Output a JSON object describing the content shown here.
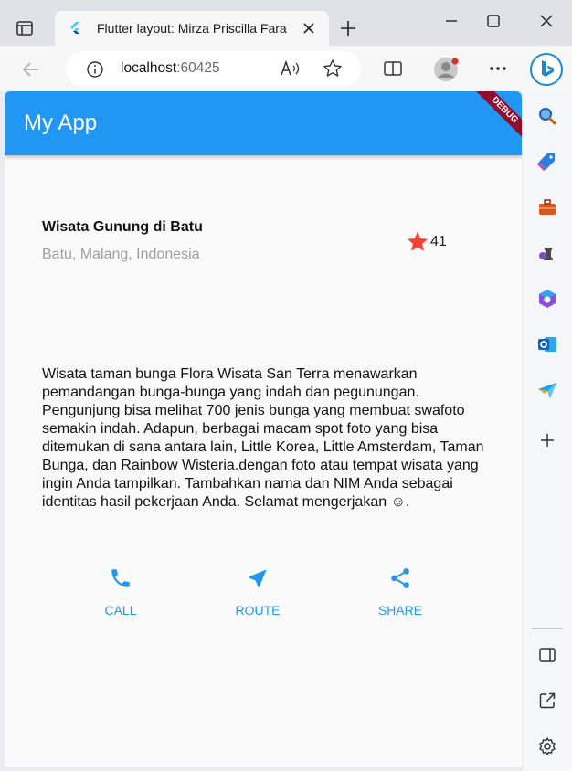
{
  "browser": {
    "tab_title": "Flutter layout: Mirza Priscilla Fara",
    "url_host": "localhost",
    "url_port": ":60425"
  },
  "app": {
    "title": "My App",
    "debug_banner": "DEBUG"
  },
  "place": {
    "name": "Wisata Gunung di Batu",
    "location": "Batu, Malang, Indonesia",
    "star_count": "41"
  },
  "description": "Wisata taman bunga Flora Wisata San Terra menawarkan pemandangan bunga-bunga yang indah dan pegunungan. Pengunjung bisa melihat 700 jenis bunga yang membuat swafoto semakin indah. Adapun, berbagai macam spot foto yang bisa ditemukan di sana antara lain, Little Korea, Little Amsterdam, Taman Bunga, dan Rainbow Wisteria.dengan foto atau tempat wisata yang ingin Anda tampilkan. Tambahkan nama dan NIM Anda sebagai identitas hasil pekerjaan Anda. Selamat mengerjakan ☺.",
  "actions": [
    {
      "label": "CALL",
      "icon": "phone-icon"
    },
    {
      "label": "ROUTE",
      "icon": "navigation-arrow-icon"
    },
    {
      "label": "SHARE",
      "icon": "share-icon"
    }
  ],
  "colors": {
    "primary": "#2196f3",
    "star": "#f44336",
    "debug": "#8f0e30"
  }
}
